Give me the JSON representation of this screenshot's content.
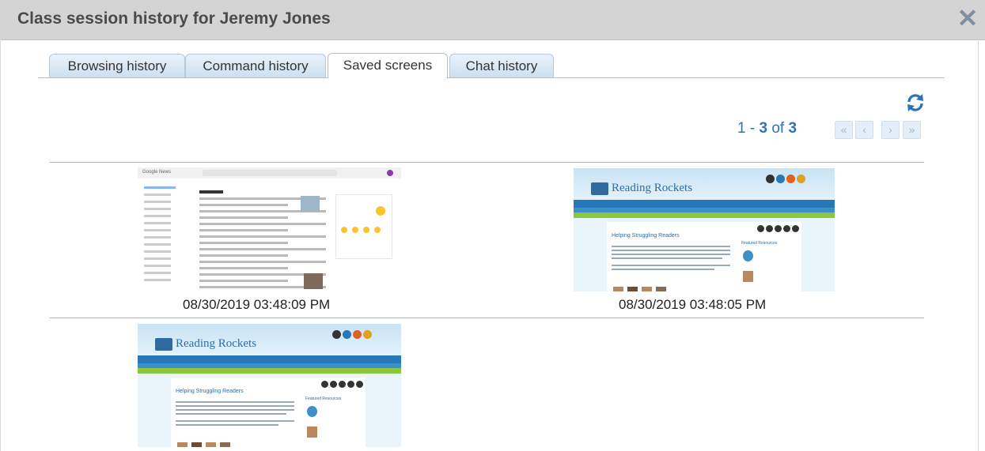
{
  "dialog": {
    "title": "Class session history for Jeremy Jones",
    "close_glyph": "✕"
  },
  "tabs": [
    {
      "label": "Browsing history",
      "active": false
    },
    {
      "label": "Command history",
      "active": false
    },
    {
      "label": "Saved screens",
      "active": true
    },
    {
      "label": "Chat history",
      "active": false
    }
  ],
  "toolbar": {
    "refresh_icon": "refresh-icon"
  },
  "pager": {
    "range_start": "1",
    "range_sep": " - ",
    "range_end": "3",
    "of_word": " of ",
    "total": "3",
    "first": "«",
    "prev": "‹",
    "next": "›",
    "last": "»"
  },
  "screens": [
    {
      "timestamp": "08/30/2019 03:48:09 PM",
      "kind": "Google News"
    },
    {
      "timestamp": "08/30/2019 03:48:05 PM",
      "kind": "Reading Rockets"
    },
    {
      "timestamp": "",
      "kind": "Reading Rockets"
    }
  ],
  "thumb_text": {
    "google_logo": "Google News",
    "reading_rockets": "Reading Rockets",
    "helping": "Helping Struggling Readers",
    "featured": "Featured Resources"
  },
  "colors": {
    "accent": "#2e73b8",
    "titlebar": "#d4d4d4"
  }
}
